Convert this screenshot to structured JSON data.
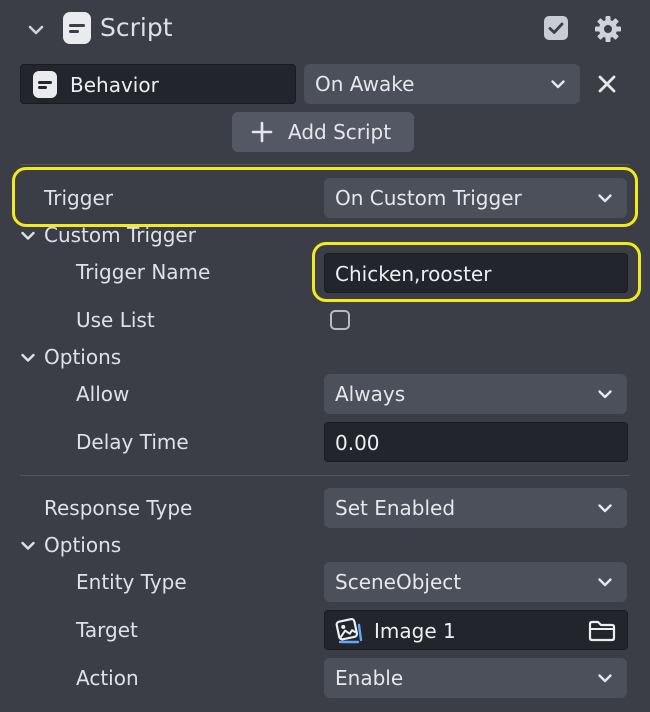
{
  "header": {
    "title": "Script",
    "checkbox_checked": true
  },
  "script_row": {
    "script_name": "Behavior",
    "event": "On Awake"
  },
  "add_script_label": "Add Script",
  "trigger": {
    "label": "Trigger",
    "value": "On Custom Trigger"
  },
  "custom_trigger": {
    "section_label": "Custom Trigger",
    "trigger_name_label": "Trigger Name",
    "trigger_name_value": "Chicken,rooster",
    "use_list_label": "Use List",
    "use_list_checked": false
  },
  "options1": {
    "section_label": "Options",
    "allow_label": "Allow",
    "allow_value": "Always",
    "delay_label": "Delay Time",
    "delay_value": "0.00"
  },
  "response": {
    "label": "Response Type",
    "value": "Set Enabled"
  },
  "options2": {
    "section_label": "Options",
    "entity_type_label": "Entity Type",
    "entity_type_value": "SceneObject",
    "target_label": "Target",
    "target_value": "Image 1",
    "action_label": "Action",
    "action_value": "Enable"
  },
  "colors": {
    "panel_bg": "#3b3e47",
    "field_bg": "#4c505b",
    "input_bg": "#22252b",
    "highlight": "#f2ea1c",
    "accent_blue": "#5fa8ff"
  }
}
